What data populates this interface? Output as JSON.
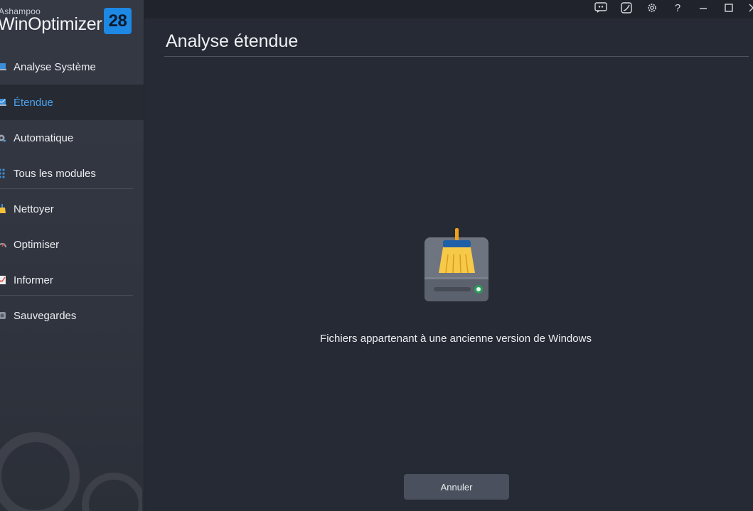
{
  "brand": {
    "vendor": "Ashampoo",
    "product": "WinOptimizer",
    "version": "28",
    "accent": "#1e88e5"
  },
  "sidebar": {
    "items": [
      {
        "label": "Analyse Système",
        "icon": "laptop-icon",
        "active": false
      },
      {
        "label": "Étendue",
        "icon": "laptop-chart-icon",
        "active": true
      },
      {
        "label": "Automatique",
        "icon": "gear-play-icon",
        "active": false
      },
      {
        "label": "Tous les modules",
        "icon": "grid-dots-icon",
        "active": false
      },
      {
        "label": "Nettoyer",
        "icon": "broom-icon",
        "active": false
      },
      {
        "label": "Optimiser",
        "icon": "gauge-icon",
        "active": false
      },
      {
        "label": "Informer",
        "icon": "chart-icon",
        "active": false
      },
      {
        "label": "Sauvegardes",
        "icon": "disk-icon",
        "active": false
      }
    ],
    "active_color": "#4aa3ef"
  },
  "titlebar": {
    "buttons": [
      "feedback-icon",
      "theme-icon",
      "settings-icon",
      "help-icon",
      "minimize-icon",
      "maximize-icon",
      "close-icon"
    ],
    "help_glyph": "?"
  },
  "main": {
    "title": "Analyse étendue",
    "hero_icon": "drive-broom-icon",
    "status": "Fichiers appartenant à une ancienne version de Windows",
    "cancel_label": "Annuler"
  }
}
